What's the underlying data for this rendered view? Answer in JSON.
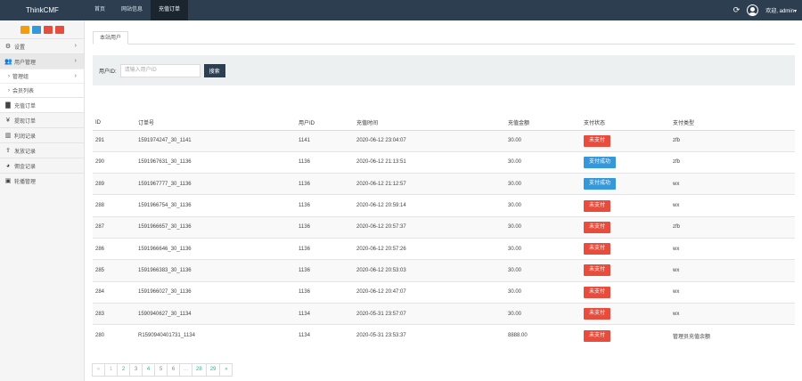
{
  "app": {
    "brand": "ThinkCMF"
  },
  "topnav": [
    {
      "label": "首页",
      "active": false
    },
    {
      "label": "网站信息",
      "active": false
    },
    {
      "label": "充值订单",
      "active": true
    }
  ],
  "topright": {
    "user": "欢迎, admin▾",
    "refresh_icon": "refresh-icon"
  },
  "sidebar": {
    "quick_colors": [
      "#f39c12",
      "#3498db",
      "#e74c3c",
      "#e74c3c"
    ],
    "items": [
      {
        "label": "设置",
        "icon": "gear-icon",
        "glyph": "⚙",
        "has_children": true
      },
      {
        "label": "用户管理",
        "icon": "users-icon",
        "glyph": "👥",
        "has_children": true,
        "open": true
      },
      {
        "label": "管理组",
        "sub": true,
        "has_children": true
      },
      {
        "label": "会员列表",
        "sub": true
      },
      {
        "label": "充值订单",
        "icon": "chart-icon",
        "glyph": "▇",
        "current": true
      },
      {
        "label": "提现订单",
        "icon": "yen-icon",
        "glyph": "¥"
      },
      {
        "label": "利润记录",
        "icon": "chart-bar-icon",
        "glyph": "▥"
      },
      {
        "label": "发放记录",
        "icon": "upload-icon",
        "glyph": "⇪"
      },
      {
        "label": "佣金记录",
        "icon": "pie-icon",
        "glyph": "◕"
      },
      {
        "label": "轮播管理",
        "icon": "image-icon",
        "glyph": "▣"
      }
    ]
  },
  "tab": {
    "label": "本站用户"
  },
  "filter": {
    "label": "用户ID:",
    "placeholder": "请输入用户ID",
    "button": "搜索"
  },
  "table": {
    "headers": [
      "ID",
      "订单号",
      "用户ID",
      "充值时间",
      "充值金额",
      "支付状态",
      "支付类型"
    ],
    "rows": [
      [
        "291",
        "1591974247_30_1141",
        "1141",
        "2020-06-12 23:04:07",
        "30.00",
        "未支付",
        "zfb"
      ],
      [
        "290",
        "1591967631_30_1136",
        "1136",
        "2020-06-12 21:13:51",
        "30.00",
        "支付成功",
        "zfb"
      ],
      [
        "289",
        "1591967777_30_1136",
        "1136",
        "2020-06-12 21:12:57",
        "30.00",
        "支付成功",
        "wx"
      ],
      [
        "288",
        "1591966754_30_1136",
        "1136",
        "2020-06-12 20:59:14",
        "30.00",
        "未支付",
        "wx"
      ],
      [
        "287",
        "1591966657_30_1136",
        "1136",
        "2020-06-12 20:57:37",
        "30.00",
        "未支付",
        "zfb"
      ],
      [
        "286",
        "1591966646_30_1136",
        "1136",
        "2020-06-12 20:57:26",
        "30.00",
        "未支付",
        "wx"
      ],
      [
        "285",
        "1591966383_30_1136",
        "1136",
        "2020-06-12 20:53:03",
        "30.00",
        "未支付",
        "wx"
      ],
      [
        "284",
        "1591966027_30_1136",
        "1136",
        "2020-06-12 20:47:07",
        "30.00",
        "未支付",
        "wx"
      ],
      [
        "283",
        "1590940627_30_1134",
        "1134",
        "2020-05-31 23:57:07",
        "30.00",
        "未支付",
        "wx"
      ],
      [
        "280",
        "R1590940401731_1134",
        "1134",
        "2020-05-31 23:53:37",
        "8888.00",
        "未支付",
        "管理员充值余额"
      ]
    ],
    "status_colors": {
      "未支付": "#e74c3c",
      "支付成功": "#3498db"
    }
  },
  "pager": [
    "«",
    "1",
    "2",
    "3",
    "4",
    "5",
    "6",
    "...",
    "28",
    "29",
    "»"
  ]
}
